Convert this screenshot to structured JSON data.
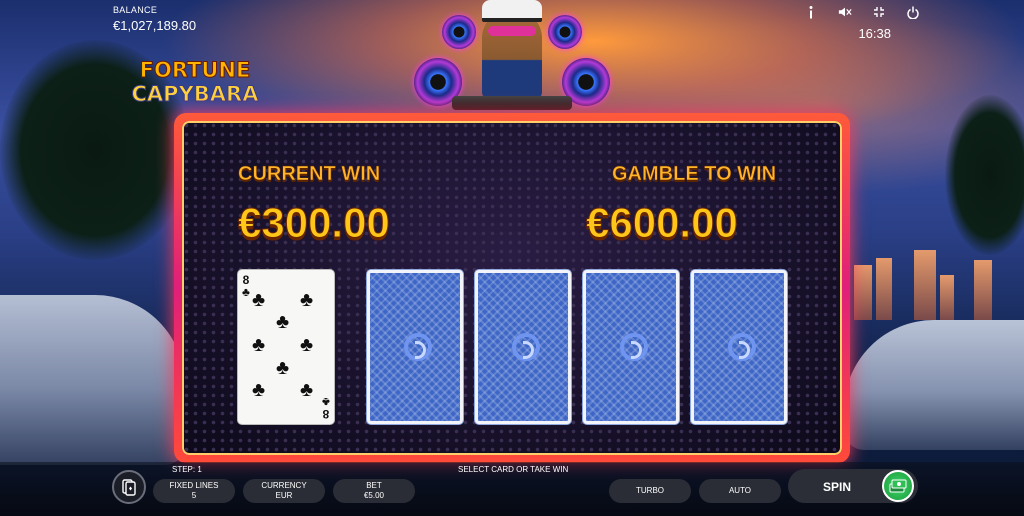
{
  "header": {
    "balance_label": "BALANCE",
    "balance_value": "€1,027,189.80",
    "time": "16:38",
    "icons": [
      "info-icon",
      "mute-icon",
      "fullscreen-icon",
      "power-icon"
    ]
  },
  "logo": {
    "line1": "FORTUNE",
    "line2": "CAPYBARA"
  },
  "gamble": {
    "current_win_label": "CURRENT WIN",
    "current_win_value": "€300.00",
    "gamble_label": "GAMBLE TO WIN",
    "gamble_value": "€600.00",
    "revealed_card": {
      "rank": "8",
      "suit": "♣",
      "suit_name": "clubs"
    },
    "face_down_cards": 4
  },
  "footer": {
    "step": "STEP: 1",
    "hint": "SELECT CARD OR TAKE WIN",
    "fixed_lines_label": "FIXED LINES",
    "fixed_lines_value": "5",
    "currency_label": "CURRENCY",
    "currency_value": "EUR",
    "bet_label": "BET",
    "bet_value": "€5.00",
    "turbo_label": "TURBO",
    "auto_label": "AUTO",
    "spin_label": "SPIN"
  },
  "colors": {
    "win_text": "#ffc61a",
    "panel_border": "#ff3a5a",
    "card_back": "#3d66c6",
    "spin_accent": "#2fbf55"
  }
}
